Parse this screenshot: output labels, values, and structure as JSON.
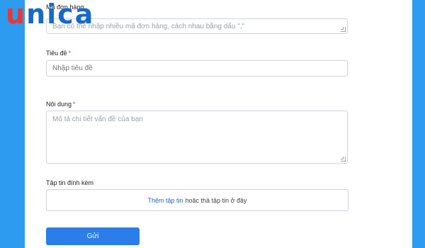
{
  "logo": {
    "letters": [
      "u",
      "n",
      "i",
      "c",
      "a"
    ],
    "colors": [
      "#e53935",
      "#1769c8",
      "#1769c8",
      "#1769c8",
      "#1769c8"
    ]
  },
  "form": {
    "order_code": {
      "label": "Mã đơn hàng",
      "placeholder": "Bạn có thể nhập nhiều mã đơn hàng, cách nhau bằng dấu \",\""
    },
    "title": {
      "label": "Tiêu đề",
      "required_mark": "*",
      "placeholder": "Nhập tiêu đề"
    },
    "content": {
      "label": "Nội dung",
      "required_mark": "*",
      "placeholder": "Mô tả chi tiết vấn đề của bạn"
    },
    "attachment": {
      "label": "Tập tin đính kèm",
      "link_text": "Thêm tập tin",
      "hint_text": "hoặc thả tập tin ở đây"
    },
    "submit_label": "Gửi"
  },
  "colors": {
    "background": "#2d9cf0",
    "button": "#2b7de9",
    "link": "#1769c8",
    "required": "#e53935"
  }
}
